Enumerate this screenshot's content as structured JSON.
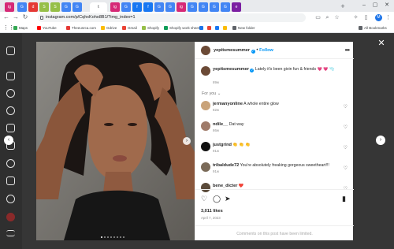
{
  "browser": {
    "tabs": [
      {
        "icon": "ig",
        "color": "#d62976"
      },
      {
        "icon": "G",
        "color": "#4285f4"
      },
      {
        "icon": "d",
        "color": "#e53935"
      },
      {
        "icon": "S",
        "color": "#96bf48"
      },
      {
        "icon": "S",
        "color": "#96bf48"
      },
      {
        "icon": "G",
        "color": "#4285f4"
      },
      {
        "icon": "G",
        "color": "#4285f4"
      },
      {
        "icon": "t",
        "color": "#ffffff"
      },
      {
        "icon": "ig",
        "color": "#d62976"
      },
      {
        "icon": "G",
        "color": "#4285f4"
      },
      {
        "icon": "f",
        "color": "#1877f2"
      },
      {
        "icon": "f",
        "color": "#1877f2"
      },
      {
        "icon": "G",
        "color": "#4285f4"
      },
      {
        "icon": "G",
        "color": "#4285f4"
      },
      {
        "icon": "ig",
        "color": "#d62976"
      },
      {
        "icon": "G",
        "color": "#4285f4"
      },
      {
        "icon": "G",
        "color": "#4285f4"
      },
      {
        "icon": "G",
        "color": "#4285f4"
      },
      {
        "icon": "G",
        "color": "#4285f4"
      },
      {
        "icon": "e",
        "color": "#7b1fa2"
      }
    ],
    "url": "instagram.com/p/CqhxKoho8B1/?img_index=1",
    "profile_initial": "M",
    "bookmarks": [
      {
        "label": "Maps",
        "color": "#34a853"
      },
      {
        "label": "YouTube",
        "color": "#ff0000"
      },
      {
        "label": "Theeusrca.com",
        "color": "#e53935"
      },
      {
        "label": "Gdrive",
        "color": "#fbbc04"
      },
      {
        "label": "Gmail",
        "color": "#ea4335"
      },
      {
        "label": "Shopify",
        "color": "#96bf48"
      },
      {
        "label": "Shopify work sheet",
        "color": "#0f9d58"
      },
      {
        "label": "",
        "color": "#1a73e8"
      },
      {
        "label": "",
        "color": "#ea4335"
      },
      {
        "label": "",
        "color": "#1877f2"
      },
      {
        "label": "",
        "color": "#fbbc04"
      },
      {
        "label": "New folder",
        "color": "#5f6368"
      }
    ],
    "all_bookmarks": "All Bookmarks"
  },
  "post": {
    "username": "yepitsmesummer",
    "follow_label": "Follow",
    "separator": "•",
    "caption": "Lately it's been givin fun & friends 💗 💗 🫧",
    "caption_time": "89w",
    "for_you_label": "For you",
    "comments": [
      {
        "user": "jermanyonline",
        "text": "A whole entire glow",
        "time": "82w",
        "avatar_color": "#c9a37a"
      },
      {
        "user": "ndile__",
        "text": "Dat way",
        "time": "86w",
        "avatar_color": "#9f7b6a"
      },
      {
        "user": "justgrind",
        "text": "👏 👏 👏",
        "time": "91w",
        "avatar_color": "#111111"
      },
      {
        "user": "tribaldude72",
        "text": "You're absolutely freaking gorgeous sweetheart!!!",
        "time": "91w",
        "avatar_color": "#7a6a58"
      },
      {
        "user": "bene_dicter",
        "text": "❤️",
        "time": "",
        "avatar_color": "#5a4a3a"
      }
    ],
    "likes": "3,011 likes",
    "date": "April 7, 2023",
    "comments_limited": "Comments on this post have been limited.",
    "carousel_count": 8,
    "carousel_active": 0
  },
  "colors": {
    "accent": "#0095f6",
    "overlay": "#363636"
  }
}
